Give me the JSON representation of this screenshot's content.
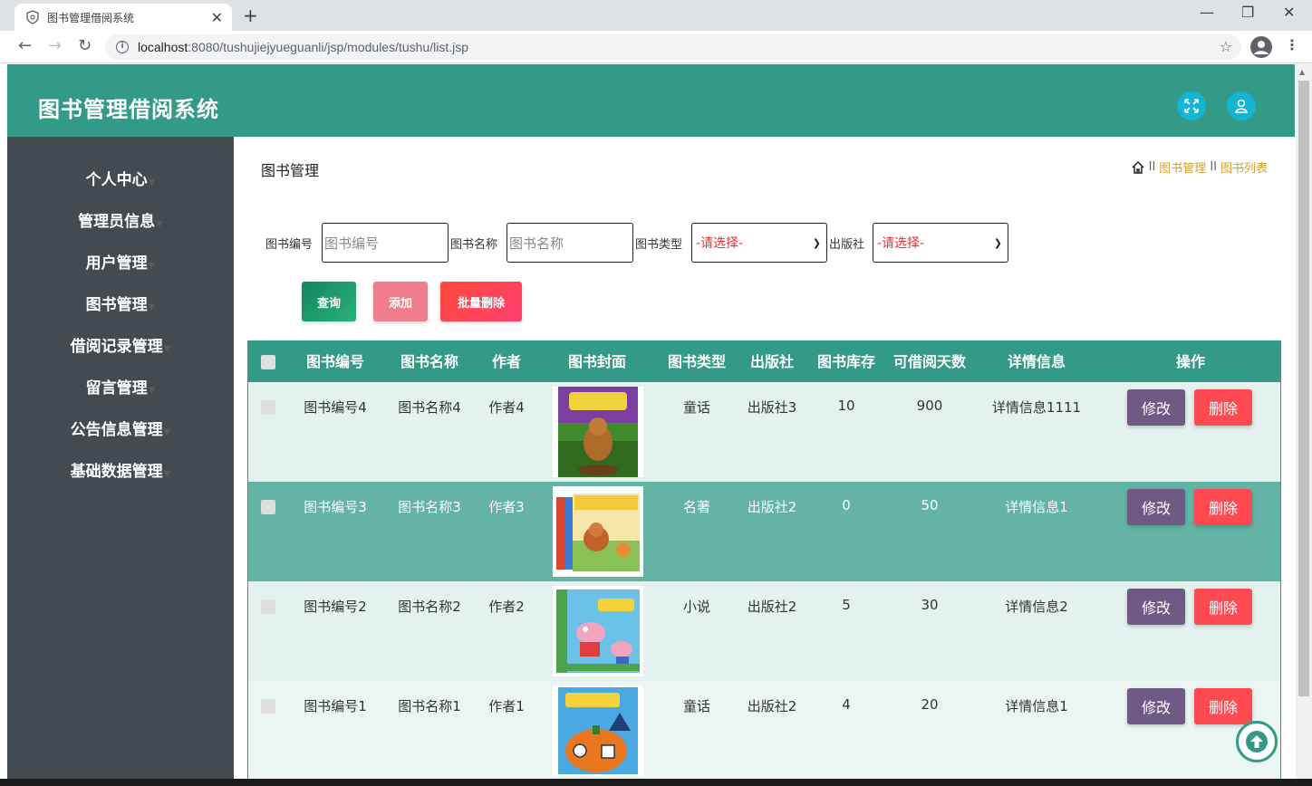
{
  "browser": {
    "tab_title": "图书管理借阅系统",
    "url_host": "localhost",
    "url_rest": ":8080/tushujiejyueguanli/jsp/modules/tushu/list.jsp"
  },
  "header": {
    "title": "图书管理借阅系统"
  },
  "sidebar": {
    "items": [
      {
        "label": "个人中心"
      },
      {
        "label": "管理员信息"
      },
      {
        "label": "用户管理"
      },
      {
        "label": "图书管理"
      },
      {
        "label": "借阅记录管理"
      },
      {
        "label": "留言管理"
      },
      {
        "label": "公告信息管理"
      },
      {
        "label": "基础数据管理"
      }
    ]
  },
  "page": {
    "heading": "图书管理",
    "breadcrumb": [
      "图书管理",
      "图书列表"
    ],
    "breadcrumb_sep": "II"
  },
  "filters": {
    "book_no_label": "图书编号",
    "book_no_placeholder": "图书编号",
    "book_name_label": "图书名称",
    "book_name_placeholder": "图书名称",
    "book_type_label": "图书类型",
    "book_type_value": "-请选择-",
    "publisher_label": "出版社",
    "publisher_value": "-请选择-"
  },
  "actions": {
    "query": "查询",
    "add": "添加",
    "batch_delete": "批量删除"
  },
  "table": {
    "columns": [
      "图书编号",
      "图书名称",
      "作者",
      "图书封面",
      "图书类型",
      "出版社",
      "图书库存",
      "可借阅天数",
      "详情信息",
      "操作"
    ],
    "edit_label": "修改",
    "delete_label": "删除",
    "rows": [
      {
        "no": "图书编号4",
        "name": "图书名称4",
        "author": "作者4",
        "type": "童话",
        "publisher": "出版社3",
        "stock": "10",
        "days": "900",
        "detail": "详情信息1111"
      },
      {
        "no": "图书编号3",
        "name": "图书名称3",
        "author": "作者3",
        "type": "名著",
        "publisher": "出版社2",
        "stock": "0",
        "days": "50",
        "detail": "详情信息1"
      },
      {
        "no": "图书编号2",
        "name": "图书名称2",
        "author": "作者2",
        "type": "小说",
        "publisher": "出版社2",
        "stock": "5",
        "days": "30",
        "detail": "详情信息2"
      },
      {
        "no": "图书编号1",
        "name": "图书名称1",
        "author": "作者1",
        "type": "童话",
        "publisher": "出版社2",
        "stock": "4",
        "days": "20",
        "detail": "详情信息1"
      }
    ]
  },
  "colors": {
    "primary": "#329a87",
    "sidebar": "#434a50",
    "row_light": "#e3f2ee",
    "row_dark": "#63b4a5",
    "edit": "#6f5a85",
    "delete": "#ff4a52"
  }
}
